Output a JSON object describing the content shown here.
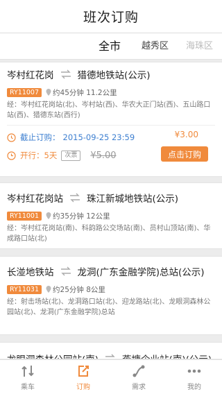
{
  "header": {
    "title": "班次订购"
  },
  "tabs": {
    "items": [
      "全市",
      "越秀区",
      "海珠区"
    ]
  },
  "cards": [
    {
      "origin": "岑村红花岗",
      "destination": "猎德地铁站(公示)",
      "code": "RY11007",
      "duration_distance": "约45分钟 11.2公里",
      "via": "经：岑村红花岗站(北)、岑村站(西)、华农大正门站(西)、五山路口站(西)、猎德东站(西行)",
      "deadline_label": "截止订购：",
      "deadline": "2015-09-25 23:59",
      "days_label": "开行：5天",
      "ticket_tag": "次票",
      "old_price": "¥5.00",
      "price": "¥3.00",
      "button": "点击订购"
    },
    {
      "origin": "岑村红花岗站",
      "destination": "珠江新城地铁站(公示)",
      "code": "RY11001",
      "duration_distance": "约35分钟 12公里",
      "via": "经：岑村红花岗站(南)、科韵路公交场站(南)、员村山顶站(南)、华成路口站(北)"
    },
    {
      "origin": "长湴地铁站",
      "destination": "龙洞(广东金融学院)总站(公示)",
      "code": "RY11031",
      "duration_distance": "约25分钟 8公里",
      "via": "经：射击场站(北)、龙洞路口站(北)、迎龙路站(北)、龙眼洞森林公园站(北)、龙洞(广东金融学院)总站"
    },
    {
      "origin": "龙眼洞森林公园站(南)",
      "destination": "燕塘企业站(南)(公示)"
    }
  ],
  "tabbar": [
    {
      "label": "乘车",
      "icon": "route-arrows-icon"
    },
    {
      "label": "订购",
      "icon": "order-icon"
    },
    {
      "label": "需求",
      "icon": "demand-icon"
    },
    {
      "label": "我的",
      "icon": "more-dots-icon"
    }
  ],
  "colors": {
    "accent": "#f08a3c",
    "link_blue": "#3d7fd0"
  }
}
